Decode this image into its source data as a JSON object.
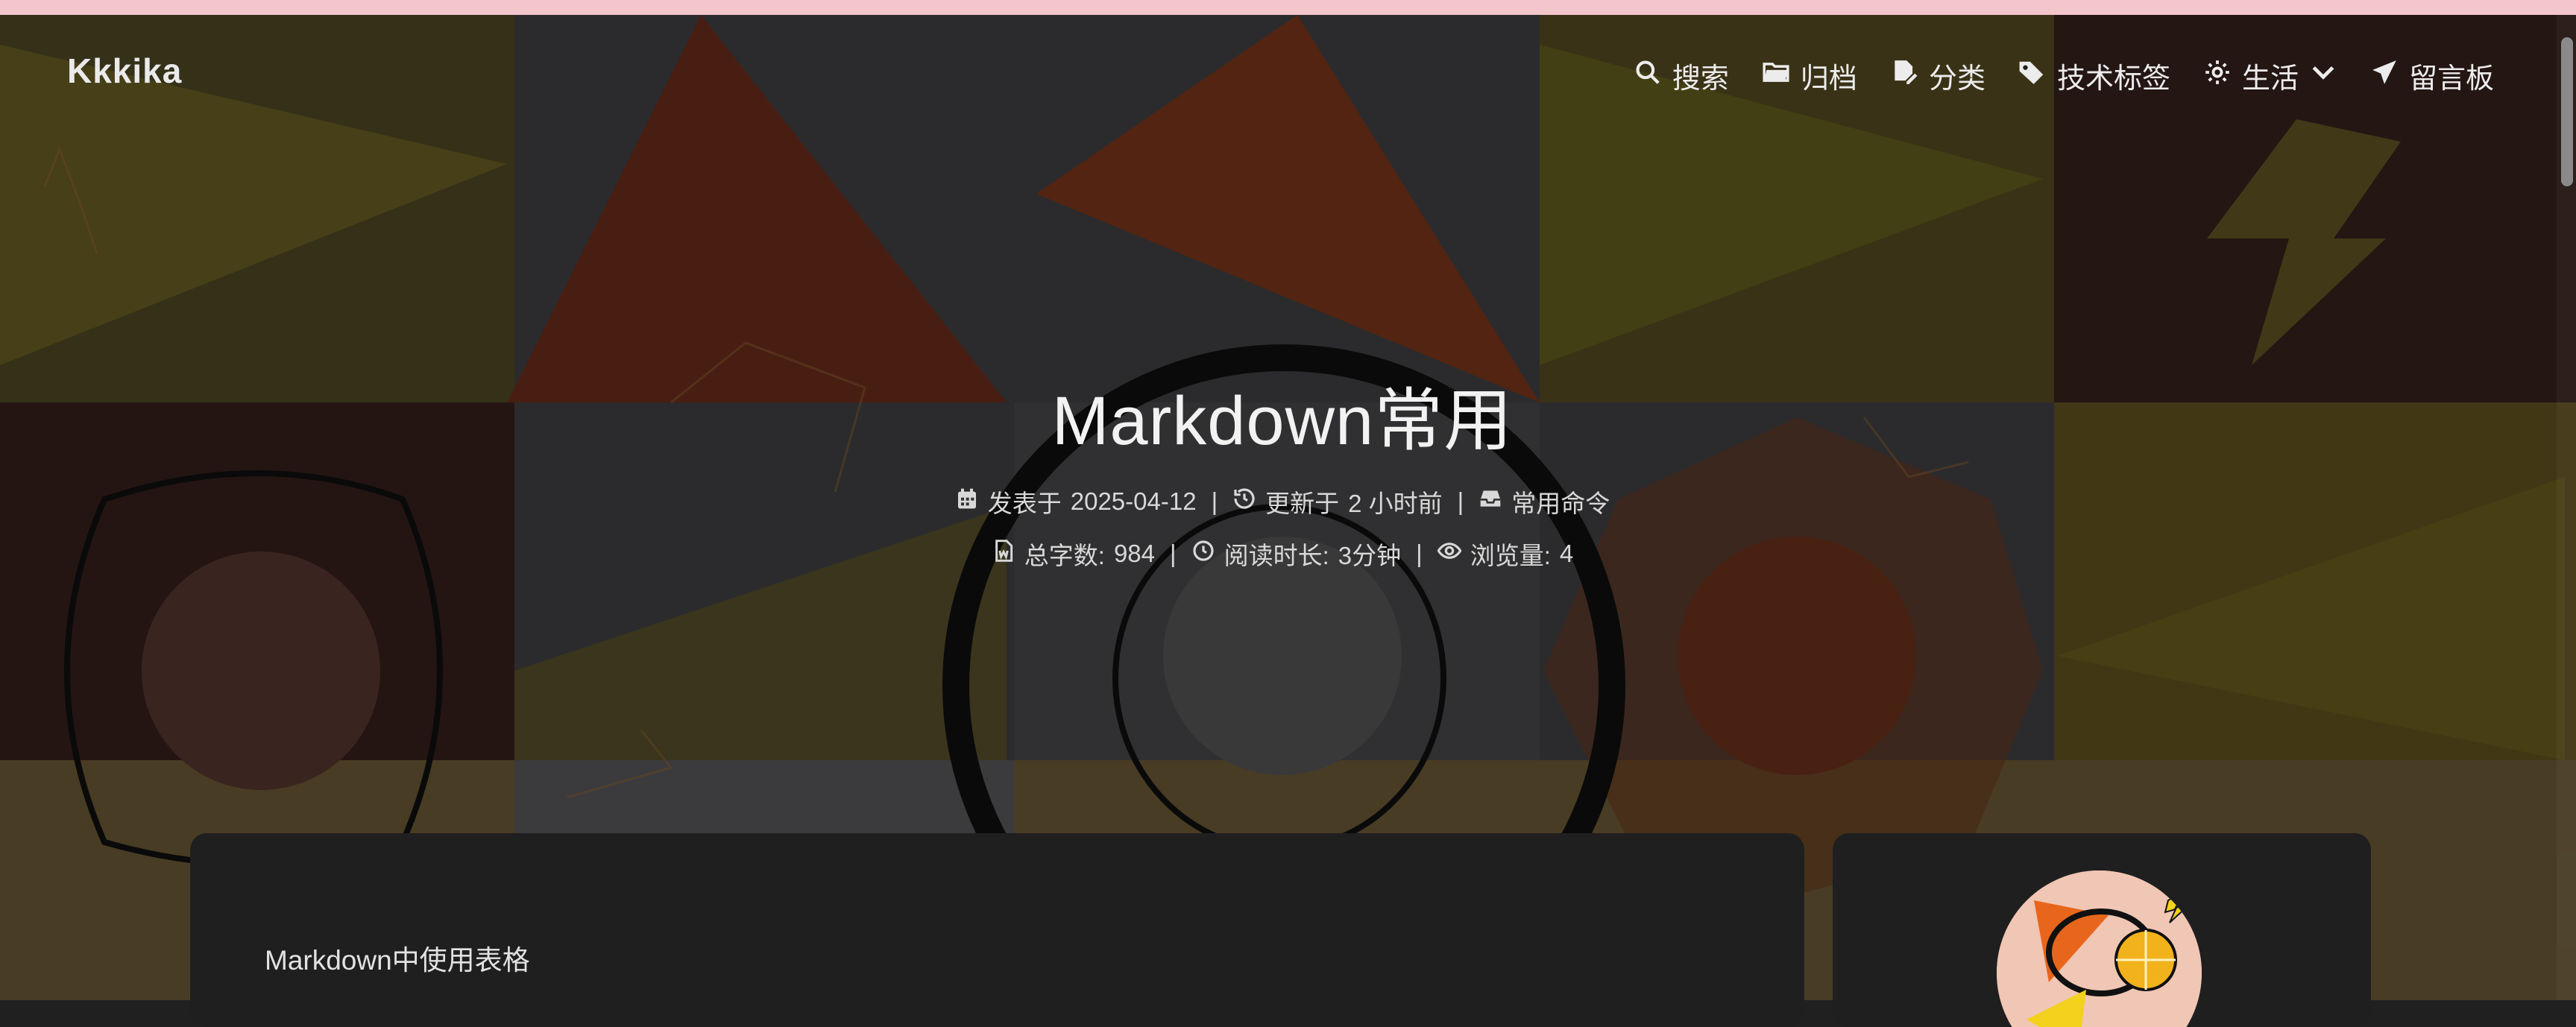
{
  "brand": "Kkkika",
  "nav": [
    {
      "icon": "search-icon",
      "label": "搜索"
    },
    {
      "icon": "folder-icon",
      "label": "归档"
    },
    {
      "icon": "file-edit-icon",
      "label": "分类"
    },
    {
      "icon": "tags-icon",
      "label": "技术标签"
    },
    {
      "icon": "gear-icon",
      "label": "生活"
    },
    {
      "icon": "paper-plane-icon",
      "label": "留言板"
    }
  ],
  "post": {
    "title": "Markdown常用",
    "published_label": "发表于",
    "published_date": "2025-04-12",
    "updated_label": "更新于",
    "updated_value": "2 小时前",
    "category": "常用命令",
    "wordcount_label": "总字数:",
    "wordcount": "984",
    "readtime_label": "阅读时长:",
    "readtime": "3分钟",
    "views_label": "浏览量:",
    "views": "4",
    "separator": "|"
  },
  "toc": {
    "first_item": "Markdown中使用表格"
  },
  "colors": {
    "top_strip": "#f3c6cc",
    "card_bg": "#1f1f1f",
    "text": "#e8e8e8"
  }
}
